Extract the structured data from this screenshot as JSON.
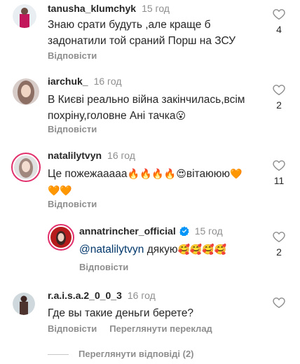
{
  "comments": [
    {
      "username": "tanusha_klumchyk",
      "time": "15 год",
      "line1": "Знаю срати будуть ,але краще б",
      "line2": "задонатили той сраний Порш на ЗСУ",
      "reply": "Відповісти",
      "likes": "4",
      "avatar_color": "#c2185b"
    },
    {
      "username": "iarchuk_",
      "time": "16 год",
      "line1": "В Києві реально війна закінчилась,всім",
      "line2": "похріну,головне Ані тачка",
      "line2_emoji": "😮",
      "reply": "Відповісти",
      "likes": "2",
      "avatar_color": "#a1887f"
    },
    {
      "username": "natalilytvyn",
      "time": "16 год",
      "line1": "Це пожежааааа",
      "line1_emoji": "🔥🔥🔥🔥😍",
      "line1_tail": "вітаююю",
      "line1_tail_emoji": "🧡",
      "line2_emoji": "🧡🧡",
      "reply": "Відповісти",
      "likes": "11",
      "avatar_color": "#bcaaa4"
    },
    {
      "username": "annatrincher_official",
      "time": "15 год",
      "mention": "@natalilytvyn",
      "line1": " дякую",
      "line1_emoji": "🥰🥰🥰🥰",
      "reply": "Відповісти",
      "likes": "2",
      "avatar_color": "#b71c1c"
    },
    {
      "username": "r.a.i.s.a.2_0_0_3",
      "time": "16 год",
      "line1": "Где вы такие деньги берете?",
      "reply": "Відповісти",
      "translate": "Переглянути переклад",
      "avatar_color": "#5d4037"
    }
  ],
  "view_replies": "Переглянути відповіді (2)",
  "colors": {
    "like_outline": "#8e8e8e",
    "verified": "#0095f6",
    "story_ring": "#e1306c"
  }
}
